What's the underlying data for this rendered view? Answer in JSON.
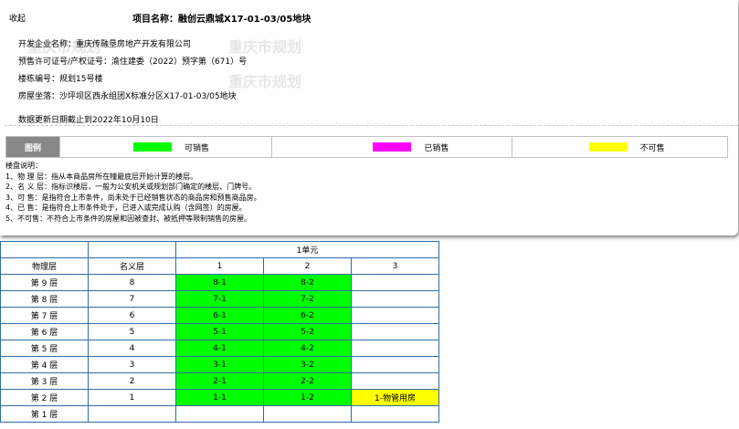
{
  "panel": {
    "collapse_label": "收起",
    "project_title": "项目名称：融创云鼎城X17-01-03/05地块",
    "watermarks": [
      "重庆市规划",
      "重庆市规划",
      "重庆市规划"
    ],
    "info": {
      "developer": "开发企业名称：重庆传融垦房地产开发有限公司",
      "permit": "预售许可证号/产权证号：渝住建委（2022）预字第（671）号",
      "building": "楼栋编号：规划15号楼",
      "location": "房屋坐落：沙坪坝区西永组团X标准分区X17-01-03/05地块"
    },
    "update_text": "数据更新日期截止到2022年10月10日",
    "legend": {
      "label": "图例",
      "items": [
        {
          "text": "可销售",
          "color": "#00ff00"
        },
        {
          "text": "已销售",
          "color": "#ff00ff"
        },
        {
          "text": "不可售",
          "color": "#ffff00"
        }
      ]
    },
    "notes": [
      "楼盘说明：",
      "1、物 理 层：指从本商品房所在幢最底层开始计算的楼层。",
      "2、名 义 层：指标识楼层，一般为公安机关或规划部门确定的楼层、门牌号。",
      "3、可 售：是指符合上市条件，尚未处于已经销售状态的商品房和预售商品房。",
      "4、已 售：是指符合上市条件处于，已进入或完成认购（含网签）的房屋。",
      "5、不可售：不符合上市条件的房屋和因被查封、被抵押等限制销售的房屋。"
    ]
  },
  "table": {
    "unit_label": "1单元",
    "col_physical": "物理层",
    "col_nominal": "名义层",
    "room_cols": [
      "1",
      "2",
      "3"
    ],
    "rows": [
      {
        "physical": "第 9 层",
        "nominal": "8",
        "rooms": [
          {
            "label": "8-1",
            "status": "sold"
          },
          {
            "label": "8-2",
            "status": "sold"
          },
          {
            "label": "",
            "status": "empty"
          }
        ]
      },
      {
        "physical": "第 8 层",
        "nominal": "7",
        "rooms": [
          {
            "label": "7-1",
            "status": "sold"
          },
          {
            "label": "7-2",
            "status": "sold"
          },
          {
            "label": "",
            "status": "empty"
          }
        ]
      },
      {
        "physical": "第 7 层",
        "nominal": "6",
        "rooms": [
          {
            "label": "6-1",
            "status": "sold"
          },
          {
            "label": "6-2",
            "status": "sold"
          },
          {
            "label": "",
            "status": "empty"
          }
        ]
      },
      {
        "physical": "第 6 层",
        "nominal": "5",
        "rooms": [
          {
            "label": "5-1",
            "status": "sold"
          },
          {
            "label": "5-2",
            "status": "sold"
          },
          {
            "label": "",
            "status": "empty"
          }
        ]
      },
      {
        "physical": "第 5 层",
        "nominal": "4",
        "rooms": [
          {
            "label": "4-1",
            "status": "sold"
          },
          {
            "label": "4-2",
            "status": "sold"
          },
          {
            "label": "",
            "status": "empty"
          }
        ]
      },
      {
        "physical": "第 4 层",
        "nominal": "3",
        "rooms": [
          {
            "label": "3-1",
            "status": "sold"
          },
          {
            "label": "3-2",
            "status": "sold"
          },
          {
            "label": "",
            "status": "empty"
          }
        ]
      },
      {
        "physical": "第 3 层",
        "nominal": "2",
        "rooms": [
          {
            "label": "2-1",
            "status": "sold"
          },
          {
            "label": "2-2",
            "status": "sold"
          },
          {
            "label": "",
            "status": "empty"
          }
        ]
      },
      {
        "physical": "第 2 层",
        "nominal": "1",
        "rooms": [
          {
            "label": "1-1",
            "status": "sold"
          },
          {
            "label": "1-2",
            "status": "sold"
          },
          {
            "label": "1-物管用房",
            "status": "unsell"
          }
        ]
      },
      {
        "physical": "第 1 层",
        "nominal": "",
        "rooms": [
          {
            "label": "",
            "status": "empty"
          },
          {
            "label": "",
            "status": "empty"
          },
          {
            "label": "",
            "status": "empty"
          }
        ]
      }
    ]
  }
}
